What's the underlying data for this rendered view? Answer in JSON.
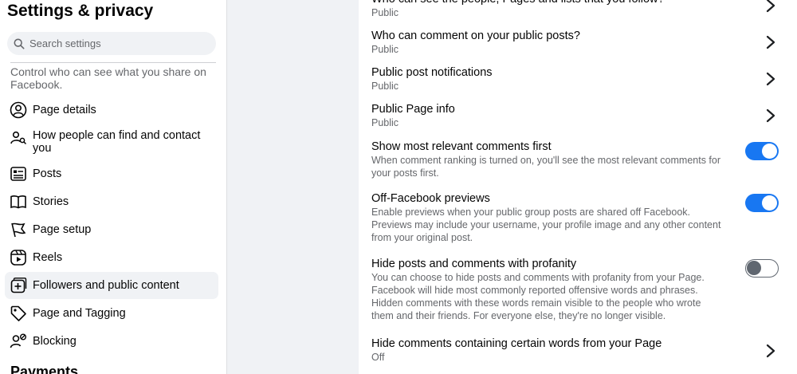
{
  "sidebar": {
    "title": "Settings & privacy",
    "search_placeholder": "Search settings",
    "description": "Control who can see what you share on Facebook.",
    "items": [
      {
        "label": "Page details",
        "icon": "person-circle-icon"
      },
      {
        "label": "How people can find and contact you",
        "icon": "people-search-icon"
      },
      {
        "label": "Posts",
        "icon": "posts-icon"
      },
      {
        "label": "Stories",
        "icon": "book-icon"
      },
      {
        "label": "Page setup",
        "icon": "flag-icon"
      },
      {
        "label": "Reels",
        "icon": "reels-icon"
      },
      {
        "label": "Followers and public content",
        "icon": "followers-icon",
        "selected": true
      },
      {
        "label": "Page and Tagging",
        "icon": "tag-icon"
      },
      {
        "label": "Blocking",
        "icon": "block-user-icon"
      }
    ],
    "next_section": "Payments"
  },
  "main": {
    "rows": [
      {
        "title": "Who can see the people, Pages and lists that you follow?",
        "sub": "Public",
        "control": "chevron"
      },
      {
        "title": "Who can comment on your public posts?",
        "sub": "Public",
        "control": "chevron"
      },
      {
        "title": "Public post notifications",
        "sub": "Public",
        "control": "chevron"
      },
      {
        "title": "Public Page info",
        "sub": "Public",
        "control": "chevron"
      },
      {
        "title": "Show most relevant comments first",
        "desc": "When comment ranking is turned on, you'll see the most relevant comments for your posts first.",
        "control": "toggle",
        "on": true
      },
      {
        "title": "Off-Facebook previews",
        "desc": "Enable previews when your public group posts are shared off Facebook. Previews may include your username, your profile image and any other content from your original post.",
        "control": "toggle",
        "on": true
      },
      {
        "title": "Hide posts and comments with profanity",
        "desc": "You can choose to hide posts and comments with profanity from your Page. Facebook will hide most commonly reported offensive words and phrases.",
        "desc2": "Hidden comments with these words remain visible to the people who wrote them and their friends. For everyone else, they're no longer visible.",
        "control": "toggle",
        "on": false
      },
      {
        "title": "Hide comments containing certain words from your Page",
        "sub": "Off",
        "control": "chevron"
      }
    ]
  },
  "colors": {
    "accent": "#1877f2",
    "page_bg": "#f0f2f5"
  }
}
